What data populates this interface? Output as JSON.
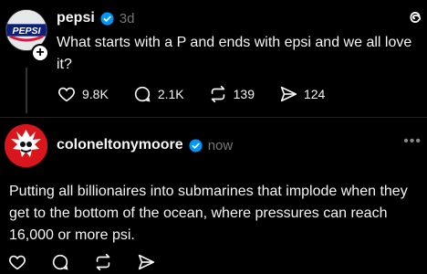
{
  "post1": {
    "username": "pepsi",
    "time": "3d",
    "text": "What starts with a P and ends with epsi and we all love it?",
    "avatar_text": "PEPSI",
    "follow_symbol": "+",
    "likes": "9.8K",
    "replies": "2.1K",
    "reposts": "139",
    "shares": "124"
  },
  "post2": {
    "username": "coloneltonymoore",
    "time": "now",
    "text": "Putting all billionaires into submarines that implode when they get to the bottom of the ocean, where pressures can reach 16,000 or more psi.",
    "more_symbol": "•••"
  },
  "icons": {
    "verified_color": "#0095f6",
    "like": "heart-icon",
    "reply": "comment-icon",
    "repost": "repost-icon",
    "share": "share-icon"
  }
}
